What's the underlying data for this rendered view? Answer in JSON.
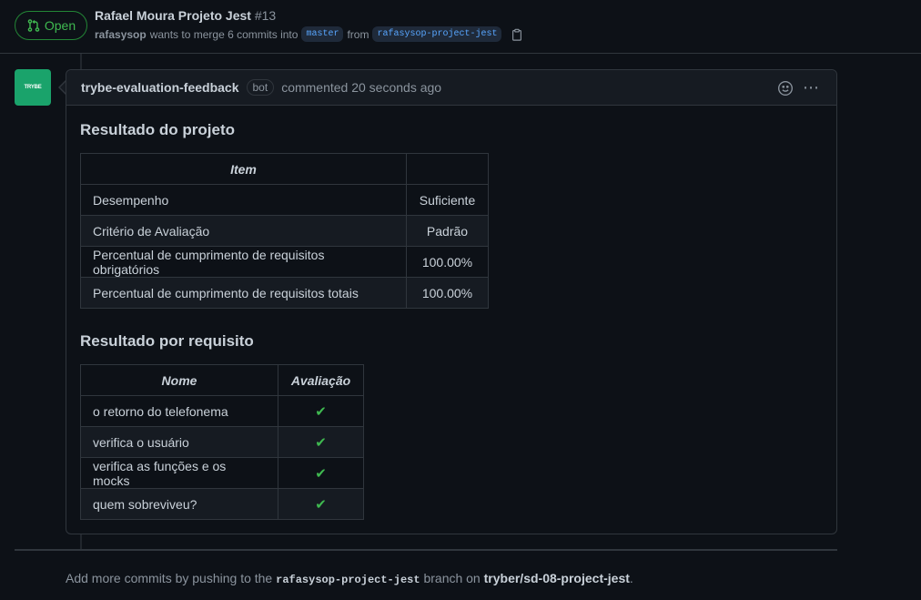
{
  "pr": {
    "status": "Open",
    "title": "Rafael Moura Projeto Jest",
    "number": "#13",
    "author": "rafasysop",
    "merge_text": "wants to merge 6 commits into",
    "base_branch": "master",
    "from_text": "from",
    "head_branch": "rafasysop-project-jest"
  },
  "comment": {
    "avatar_text": "TRYBE",
    "author": "trybe-evaluation-feedback",
    "bot_label": "bot",
    "time": "commented 20 seconds ago",
    "heading1": "Resultado do projeto",
    "table1": {
      "headers": [
        "Item",
        ""
      ],
      "rows": [
        [
          "Desempenho",
          "Suficiente"
        ],
        [
          "Critério de Avaliação",
          "Padrão"
        ],
        [
          "Percentual de cumprimento de requisitos obrigatórios",
          "100.00%"
        ],
        [
          "Percentual de cumprimento de requisitos totais",
          "100.00%"
        ]
      ]
    },
    "heading2": "Resultado por requisito",
    "table2": {
      "headers": [
        "Nome",
        "Avaliação"
      ],
      "rows": [
        [
          "o retorno do telefonema",
          "✔"
        ],
        [
          "verifica o usuário",
          "✔"
        ],
        [
          "verifica as funções e os mocks",
          "✔"
        ],
        [
          "quem sobreviveu?",
          "✔"
        ]
      ]
    }
  },
  "footer": {
    "prefix": "Add more commits by pushing to the",
    "branch": "rafasysop-project-jest",
    "middle": "branch on",
    "repo": "tryber/sd-08-project-jest",
    "suffix": "."
  },
  "colors": {
    "open_green": "#3fb950",
    "avatar_bg": "#1aa36b",
    "branch_blue": "#58a6ff"
  }
}
